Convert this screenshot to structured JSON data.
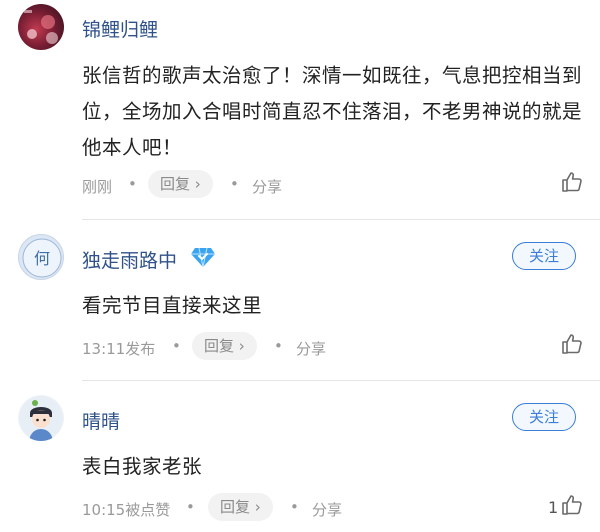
{
  "comments": [
    {
      "username": "锦鲤归鲤",
      "text": "张信哲的歌声太治愈了！深情一如既往，气息把控相当到位，全场加入合唱时简直忍不住落泪，不老男神说的就是他本人吧！",
      "time": "刚刚",
      "reply_label": "回复 ›",
      "share_label": "分享",
      "like_count": ""
    },
    {
      "username": "独走雨路中",
      "follow_label": "关注",
      "text": "看完节目直接来这里",
      "time": "13:11发布",
      "reply_label": "回复 ›",
      "share_label": "分享",
      "like_count": "",
      "avatar_text": "何"
    },
    {
      "username": "晴晴",
      "follow_label": "关注",
      "text": "表白我家老张",
      "time": "10:15被点赞",
      "reply_label": "回复 ›",
      "share_label": "分享",
      "like_count": "1"
    }
  ],
  "colors": {
    "username": "#2f5289",
    "follow": "#3b7dd8",
    "vip": "#3aa4f0"
  },
  "icons": {
    "like": "thumbs-up-icon",
    "vip": "diamond-icon"
  }
}
